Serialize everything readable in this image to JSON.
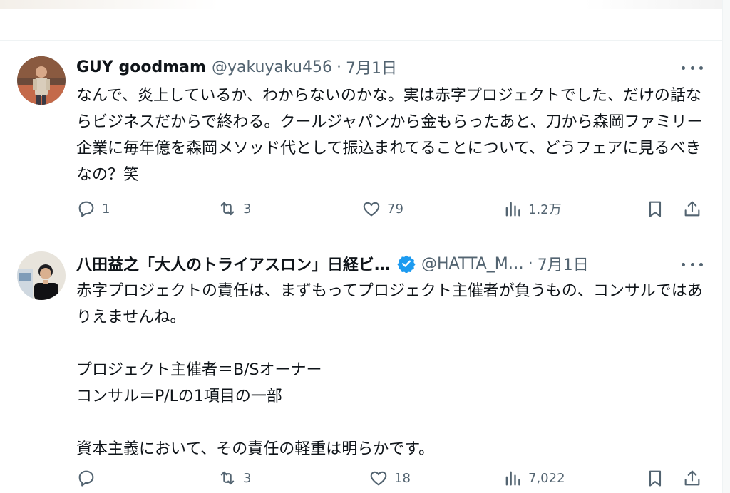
{
  "tweets": [
    {
      "name": "GUY goodmam",
      "handle": "@yakuyaku456",
      "date": "7月1日",
      "text": "なんで、炎上しているか、わからないのかな。実は赤字プロジェクトでした、だけの話ならビジネスだからで終わる。クールジャパンから金もらったあと、刀から森岡ファミリー企業に毎年億を森岡メソッド代として振込まれてることについて、どうフェアに見るべきなの？笑",
      "replies": "1",
      "reposts": "3",
      "likes": "79",
      "views": "1.2万",
      "verified": false
    },
    {
      "name": "八田益之「大人のトライアスロン」日経ビ…",
      "handle": "@HATTA_M…",
      "date": "7月1日",
      "text": "赤字プロジェクトの責任は、まずもってプロジェクト主催者が負うもの、コンサルではありえませんね。\n\nプロジェクト主催者＝B/Sオーナー\nコンサル＝P/Lの1項目の一部\n\n資本主義において、その責任の軽重は明らかです。",
      "replies": "",
      "reposts": "3",
      "likes": "18",
      "views": "7,022",
      "verified": true,
      "verified_color": "#1d9bf0"
    }
  ],
  "icons": {
    "more": "more-dots-icon",
    "reply": "reply-icon",
    "repost": "repost-icon",
    "like": "heart-icon",
    "views": "views-icon",
    "bookmark": "bookmark-icon",
    "share": "share-icon",
    "verified": "verified-badge-icon"
  }
}
